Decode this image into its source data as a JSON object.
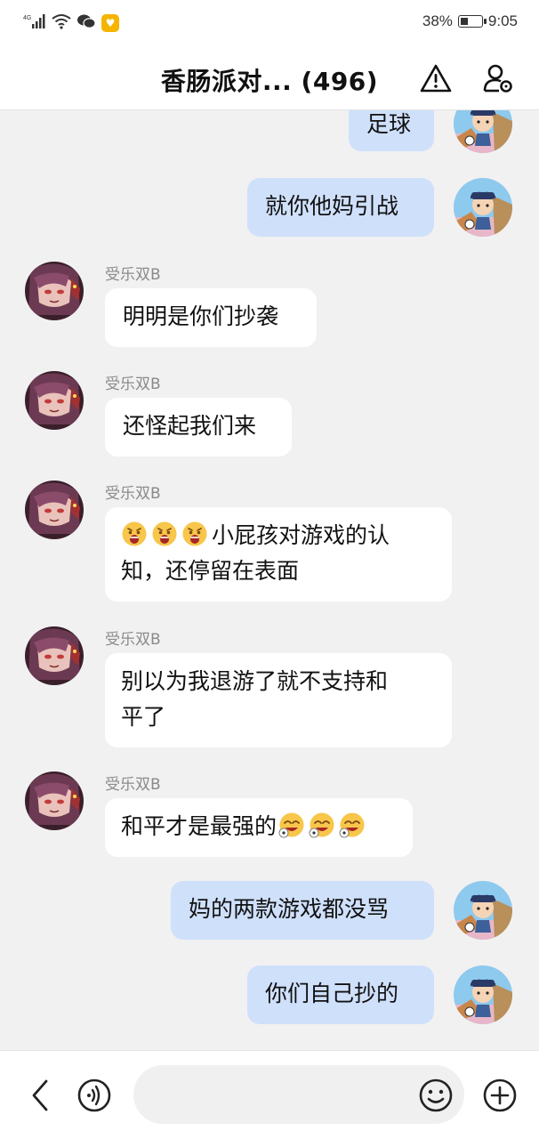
{
  "status_bar": {
    "network": "4G",
    "battery_level": 0.38,
    "battery_text": "38%",
    "time": "9:05"
  },
  "header": {
    "title": "香肠派对... (496)"
  },
  "messages": [
    {
      "side": "out",
      "text": "足球"
    },
    {
      "side": "out",
      "text": "就你他妈引战"
    },
    {
      "side": "in",
      "sender": "受乐双B",
      "text": "明明是你们抄袭"
    },
    {
      "side": "in",
      "sender": "受乐双B",
      "text": "还怪起我们来"
    },
    {
      "side": "in",
      "sender": "受乐双B",
      "emoji_prefix": [
        "shocked-face-emoji",
        "shocked-face-emoji",
        "shocked-face-emoji"
      ],
      "line1": "小屁孩对游戏的认",
      "line2": "知，还停留在表面"
    },
    {
      "side": "in",
      "sender": "受乐双B",
      "line1": "别以为我退游了就不支持和",
      "line2": "平了"
    },
    {
      "side": "in",
      "sender": "受乐双B",
      "text": "和平才是最强的",
      "emoji_suffix": [
        "dizzy-face-emoji",
        "dizzy-face-emoji",
        "dizzy-face-emoji"
      ]
    },
    {
      "side": "out",
      "text": "妈的两款游戏都没骂"
    },
    {
      "side": "out",
      "text": "你们自己抄的"
    }
  ],
  "input": {
    "value": "",
    "placeholder": ""
  },
  "colors": {
    "outgoing_bubble": "#cfe0fb",
    "incoming_bubble": "#ffffff",
    "background": "#f1f1f1"
  }
}
